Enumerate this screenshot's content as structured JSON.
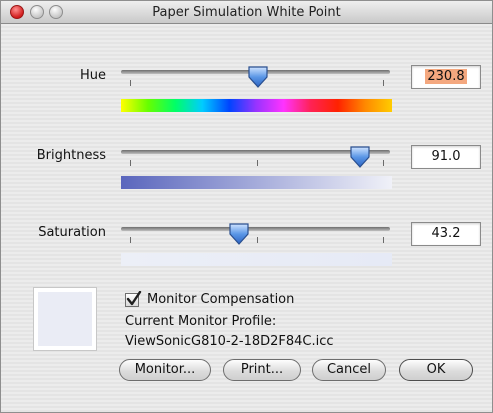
{
  "window": {
    "title": "Paper Simulation White Point"
  },
  "hue": {
    "label": "Hue",
    "value": "230.8",
    "slider_fraction": 0.5,
    "bar_colors": [
      "#ffff00",
      "#66ff00",
      "#00ff66",
      "#00ccff",
      "#0044ff",
      "#9933ff",
      "#ff33ff",
      "#ff2255",
      "#ff2200",
      "#ff8800",
      "#ffcc00"
    ]
  },
  "brightness": {
    "label": "Brightness",
    "value": "91.0",
    "slider_fraction": 0.91,
    "bar_colors": [
      "#5a66bd",
      "#f0f1f8"
    ]
  },
  "saturation": {
    "label": "Saturation",
    "value": "43.2",
    "slider_fraction": 0.432,
    "bar_colors": [
      "#eceff7",
      "#e6eaf6"
    ]
  },
  "swatch_color": "#eaecf5",
  "monitor": {
    "checkbox_label": "Monitor Compensation",
    "checked": true,
    "profile_label": "Current Monitor Profile:",
    "profile_name": "ViewSonicG810-2-18D2F84C.icc"
  },
  "buttons": {
    "monitor": "Monitor...",
    "print": "Print...",
    "cancel": "Cancel",
    "ok": "OK"
  }
}
